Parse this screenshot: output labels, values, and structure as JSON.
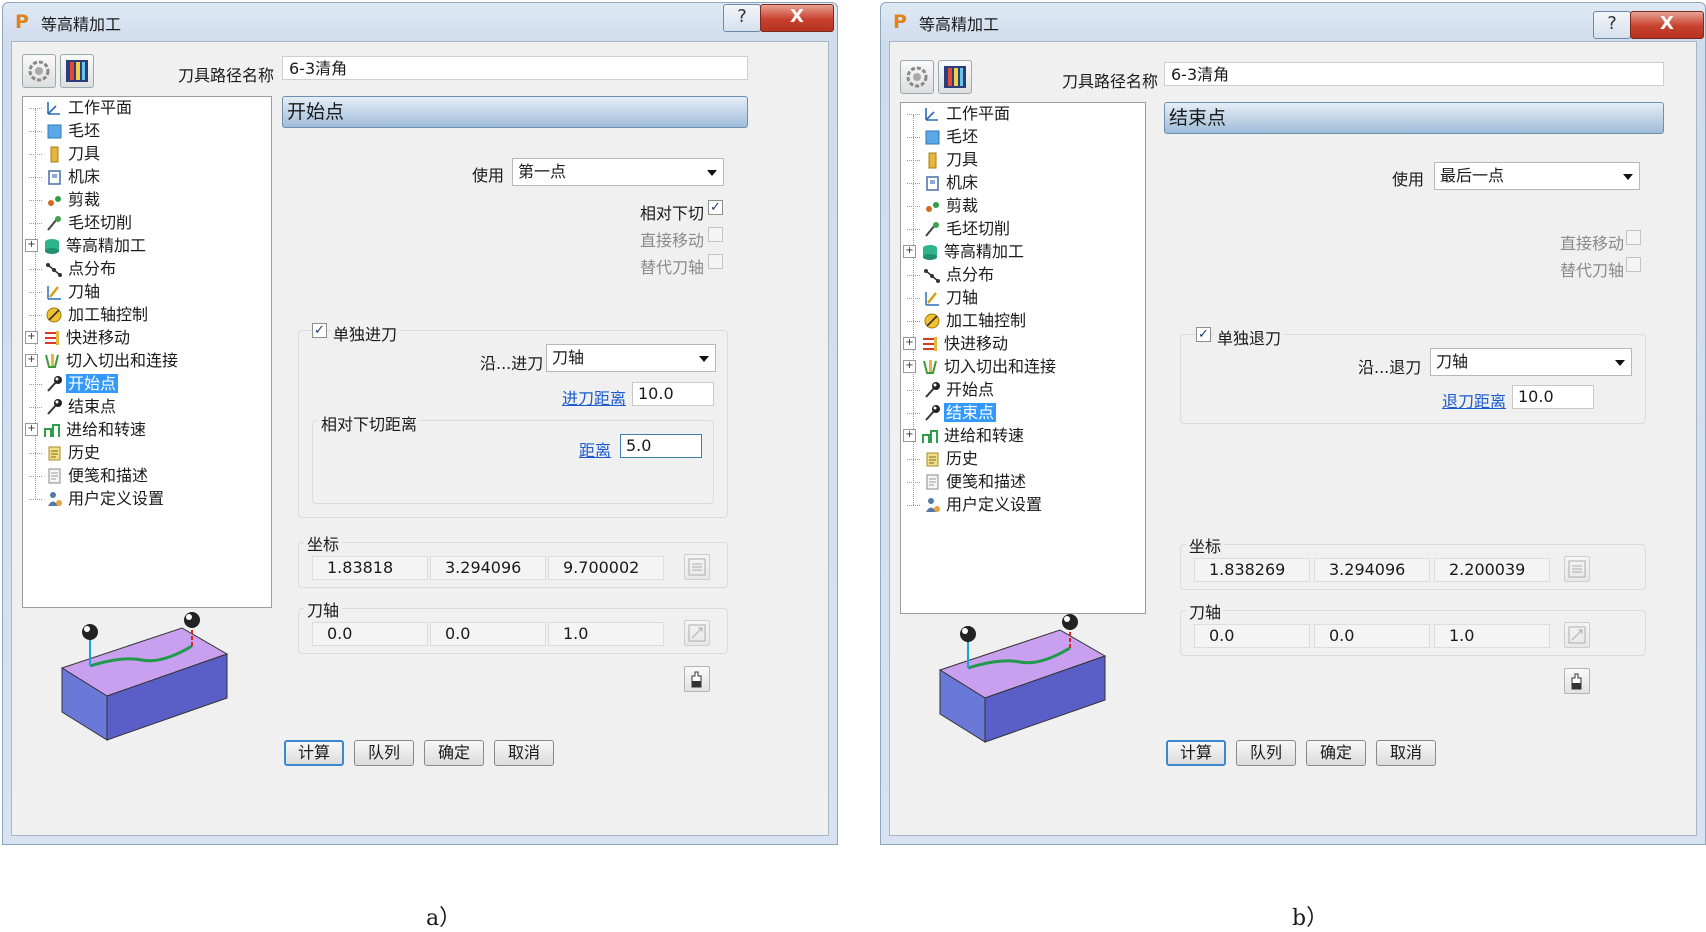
{
  "dialogs": {
    "a": {
      "window_title": "等高精加工",
      "toolpath_name_label": "刀具路径名称",
      "toolpath_name": "6-3清角",
      "section_title": "开始点",
      "use_label": "使用",
      "use_value": "第一点",
      "rel_plunge_label": "相对下切",
      "direct_move_label": "直接移动",
      "alt_axis_label": "替代刀轴",
      "separate_label": "单独进刀",
      "along_label": "沿...进刀",
      "along_value": "刀轴",
      "dist_link": "进刀距离",
      "dist_value": "10.0",
      "rel_group_title": "相对下切距离",
      "distance_link": "距离",
      "distance_value": "5.0",
      "coord_label": "坐标",
      "coord": [
        "1.83818",
        "3.294096",
        "9.700002"
      ],
      "axis_label": "刀轴",
      "axis": [
        "0.0",
        "0.0",
        "1.0"
      ]
    },
    "b": {
      "window_title": "等高精加工",
      "toolpath_name_label": "刀具路径名称",
      "toolpath_name": "6-3清角",
      "section_title": "结束点",
      "use_label": "使用",
      "use_value": "最后一点",
      "direct_move_label": "直接移动",
      "alt_axis_label": "替代刀轴",
      "separate_label": "单独退刀",
      "along_label": "沿...退刀",
      "along_value": "刀轴",
      "dist_link": "退刀距离",
      "dist_value": "10.0",
      "coord_label": "坐标",
      "coord": [
        "1.838269",
        "3.294096",
        "2.200039"
      ],
      "axis_label": "刀轴",
      "axis": [
        "0.0",
        "0.0",
        "1.0"
      ]
    }
  },
  "tree": [
    "工作平面",
    "毛坯",
    "刀具",
    "机床",
    "剪裁",
    "毛坯切削",
    "等高精加工",
    "点分布",
    "刀轴",
    "加工轴控制",
    "快进移动",
    "切入切出和连接",
    "开始点",
    "结束点",
    "进给和转速",
    "历史",
    "便笺和描述",
    "用户定义设置"
  ],
  "buttons": {
    "calc": "计算",
    "queue": "队列",
    "ok": "确定",
    "cancel": "取消"
  },
  "captions": {
    "a": "a）",
    "b": "b）"
  },
  "icons": {
    "help": "?",
    "close": "X",
    "app": "P"
  }
}
